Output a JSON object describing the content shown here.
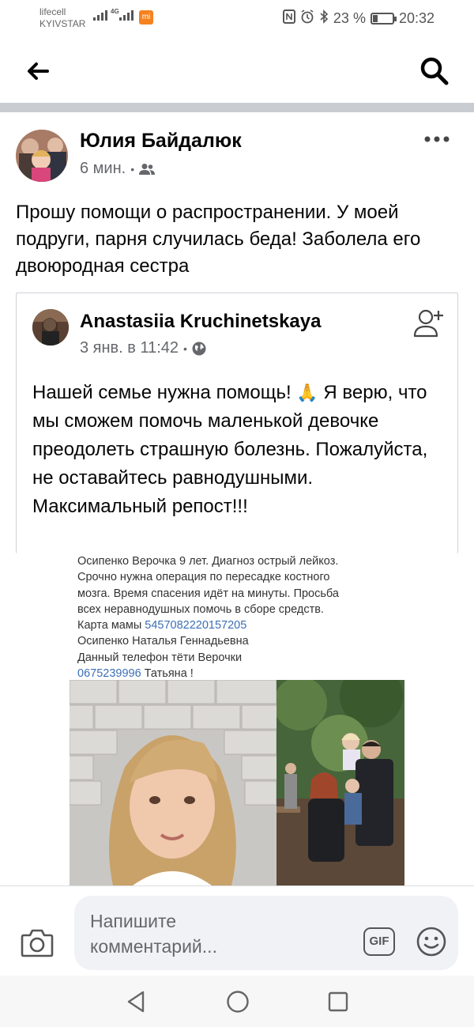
{
  "status_bar": {
    "carrier_line1": "lifecell",
    "carrier_line2": "KYIVSTAR",
    "network_label": "4G",
    "battery_text": "23 %",
    "time": "20:32",
    "icons": [
      "signal-icon",
      "nfc-icon",
      "alarm-icon",
      "bluetooth-icon",
      "battery-icon"
    ]
  },
  "header": {
    "back_icon": "arrow-left-icon",
    "search_icon": "search-icon"
  },
  "post": {
    "author": "Юлия Байдалюк",
    "time": "6 мин.",
    "dot": "•",
    "audience_icon": "friends-icon",
    "text": "Прошу помощи о распространении. У моей подруги, парня случилась беда! Заболела его двоюродная сестра",
    "shared": {
      "author": "Anastasiia Kruchinetskaya",
      "time": "3 янв. в 11:42",
      "dot": "•",
      "audience_icon": "globe-icon",
      "text_before_emoji": "Нашей семье нужна помощь! ",
      "emoji": "🙏",
      "text_after_emoji": " Я верю, что мы сможем помочь маленькой девочке преодолеть страшную болезнь. Пожалуйста, не оставайтесь равнодушными. Максимальный репост!!!"
    },
    "image": {
      "line1": "Осипенко Верочка 9 лет. Диагноз острый лейкоз.",
      "line2": "Срочно нужна операция по пересадке костного",
      "line3": "мозга. Время спасения идёт на минуты. Просьба",
      "line4": "всех неравнодушных помочь в сборе средств.",
      "line5_label": "Карта мамы ",
      "card_number": "5457082220157205",
      "line6": "Осипенко Наталья Геннадьевна",
      "line7": "Данный телефон тёти Верочки",
      "phone": "0675239996",
      "phone_suffix": " Татьяна !"
    }
  },
  "comment": {
    "placeholder_line1": "Напишите",
    "placeholder_line2": "комментарий...",
    "gif_label": "GIF"
  },
  "navbar": {
    "icons": [
      "nav-back-icon",
      "nav-home-icon",
      "nav-recent-icon"
    ]
  }
}
